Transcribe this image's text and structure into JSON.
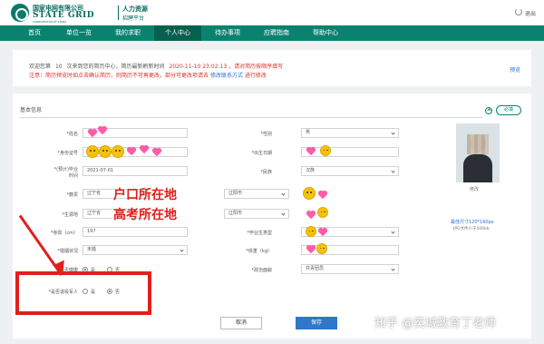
{
  "header": {
    "brand_cn": "国家电网有限公司",
    "brand_en": "STATE GRID",
    "brand_sub": "CORPORATION OF CHINA",
    "hr_title": "人力资源",
    "hr_sub": "招聘平台",
    "exit_label": "退出"
  },
  "nav": {
    "items": [
      "首页",
      "单位一览",
      "我的求职",
      "个人中心",
      "待办事项",
      "应聘指南",
      "帮助中心"
    ],
    "active": "个人中心"
  },
  "notice": {
    "line1_a": "欢迎您第",
    "visits": "10",
    "line1_b": "次来到您的简历中心，简历最新刷新时间",
    "refresh_time": "2020-11-10 23:02:13",
    "line1_c": "，请对简历按顺序填写",
    "line2_a": "注意：简历预览时如点击确认简历，则简历不可再更改，部分可更改项请去",
    "line2_link": "修改联系方式",
    "line2_b": "进行修改",
    "preview": "预览"
  },
  "basic_info": {
    "title": "基本信息",
    "required_badge": "必填",
    "labels": {
      "name": "*姓名",
      "gender": "*性别",
      "id_number": "*身份证号",
      "birth_date": "*出生日期",
      "work_time_1": "*(预计)毕业",
      "work_time_2": "时间",
      "ethnicity": "*民族",
      "native_place": "*籍贯",
      "origin": "*生源地",
      "graduate_type": "*毕业生类型",
      "height": "*身高（cm）",
      "weight": "*体重（kg）",
      "marital_status": "*婚姻状况",
      "political_status": "*政治面貌",
      "healthy": "是否健康",
      "veteran": "*是否退役军人"
    },
    "values": {
      "gender": "男",
      "graduation": "2021-07-01",
      "ethnicity": "汉族",
      "native_province": "辽宁省",
      "native_city": "辽阳市",
      "origin_province": "辽宁省",
      "origin_city": "辽阳市",
      "height": "197",
      "marital_status": "未婚",
      "political_status": "共青团员"
    },
    "radios": {
      "yes": "是",
      "no": "否",
      "healthy_selected": "是",
      "veteran_selected": "否"
    }
  },
  "annotations": {
    "hukou": "户口所在地",
    "gaokao": "高考所在地"
  },
  "photo": {
    "edit_label": "修改",
    "size_note": "最佳尺寸120*160px",
    "format_note": "JPG文件小于500kb"
  },
  "buttons": {
    "cancel": "取消",
    "save": "保存"
  },
  "watermark": "知乎 @奕城教育丁老师",
  "colors": {
    "nav_bg": "#0b8270",
    "nav_active": "#06604f",
    "save_button": "#2f77c9",
    "annotation_red": "#e0201b"
  }
}
